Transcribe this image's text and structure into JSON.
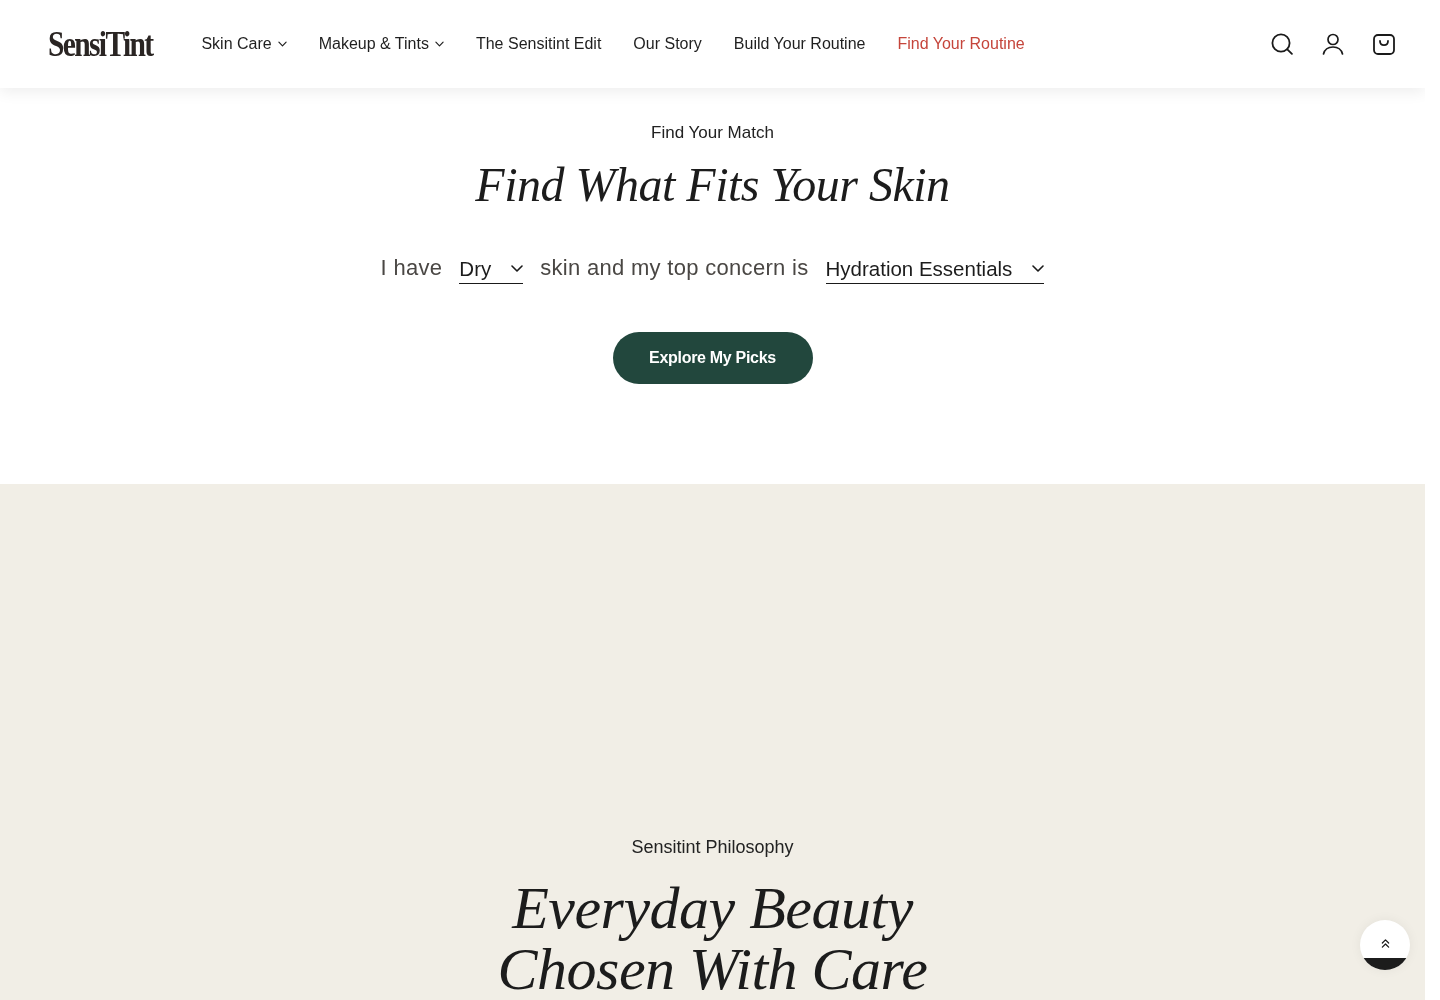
{
  "header": {
    "logo": "SensiTint",
    "nav": [
      {
        "label": "Skin Care",
        "dropdown": true,
        "selected": false
      },
      {
        "label": "Makeup & Tints",
        "dropdown": true,
        "selected": false
      },
      {
        "label": "The Sensitint Edit",
        "dropdown": false,
        "selected": false
      },
      {
        "label": "Our Story",
        "dropdown": false,
        "selected": false
      },
      {
        "label": "Build Your Routine",
        "dropdown": false,
        "selected": false
      },
      {
        "label": "Find Your Routine",
        "dropdown": false,
        "selected": true
      }
    ]
  },
  "quiz": {
    "eyebrow": "Find Your Match",
    "title": "Find What Fits Your Skin",
    "sentence": [
      {
        "kind": "text",
        "text": "I have"
      },
      {
        "kind": "select",
        "value": "Dry"
      },
      {
        "kind": "text",
        "text": "skin and my top concern is"
      },
      {
        "kind": "select",
        "value": "Hydration Essentials"
      }
    ],
    "button": "Explore My Picks"
  },
  "philosophy": {
    "eyebrow": "Sensitint Philosophy",
    "title_lines": [
      "Everyday Beauty",
      "Chosen With Care"
    ]
  }
}
